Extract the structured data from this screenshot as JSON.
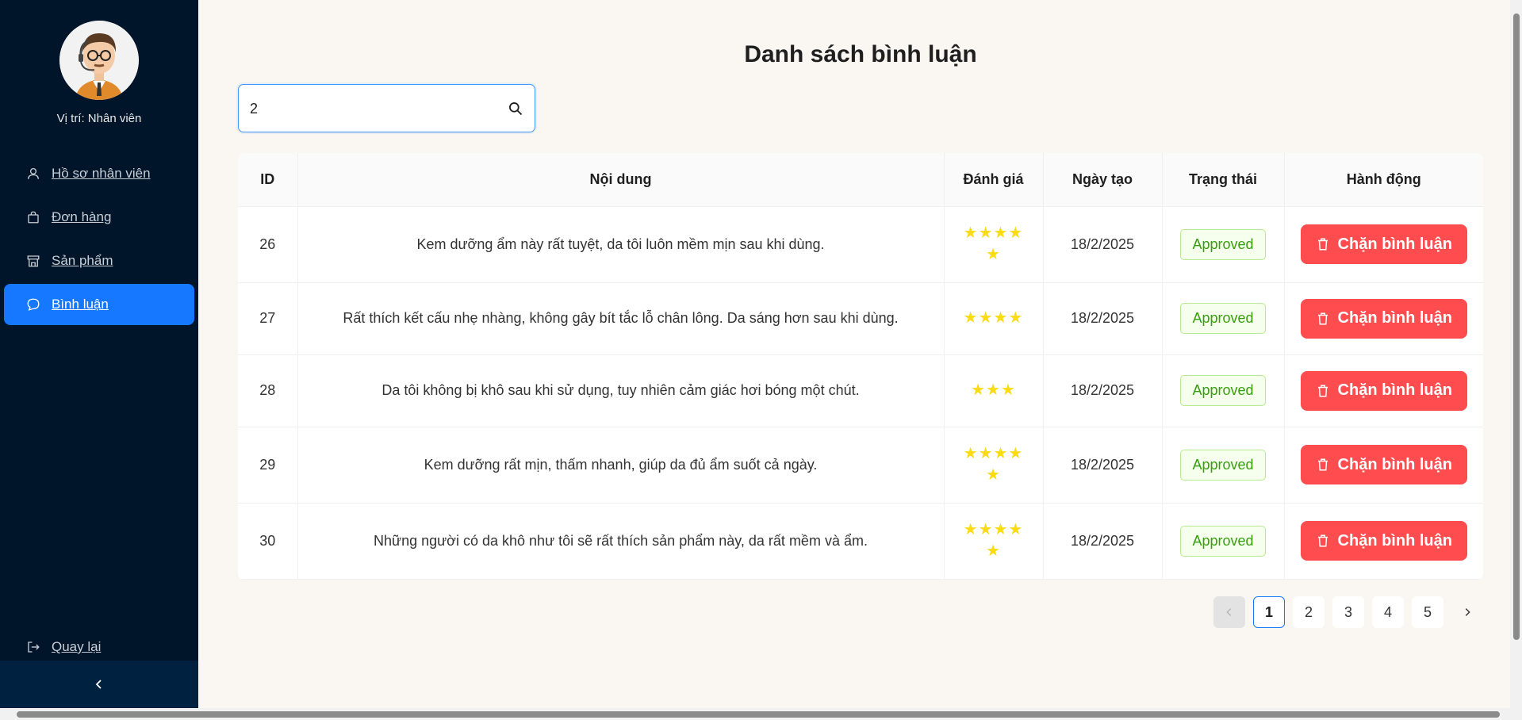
{
  "sidebar": {
    "position_label": "Vị trí: Nhân viên",
    "items": [
      {
        "label": "Hồ sơ nhân viên",
        "icon": "user-icon"
      },
      {
        "label": "Đơn hàng",
        "icon": "shopping-bag-icon"
      },
      {
        "label": "Sản phẩm",
        "icon": "shop-icon"
      },
      {
        "label": "Bình luận",
        "icon": "comment-icon",
        "active": true
      }
    ],
    "back_label": "Quay lại"
  },
  "main": {
    "title": "Danh sách bình luận",
    "search_value": "2"
  },
  "table": {
    "headers": {
      "id": "ID",
      "content": "Nội dung",
      "rating": "Đánh giá",
      "created": "Ngày tạo",
      "status": "Trạng thái",
      "action": "Hành động"
    },
    "rows": [
      {
        "id": "26",
        "content": "Kem dưỡng ẩm này rất tuyệt, da tôi luôn mềm mịn sau khi dùng.",
        "rating": 5,
        "date": "18/2/2025",
        "status": "Approved",
        "action": "Chặn bình luận"
      },
      {
        "id": "27",
        "content": "Rất thích kết cấu nhẹ nhàng, không gây bít tắc lỗ chân lông. Da sáng hơn sau khi dùng.",
        "rating": 4,
        "date": "18/2/2025",
        "status": "Approved",
        "action": "Chặn bình luận"
      },
      {
        "id": "28",
        "content": "Da tôi không bị khô sau khi sử dụng, tuy nhiên cảm giác hơi bóng một chút.",
        "rating": 3,
        "date": "18/2/2025",
        "status": "Approved",
        "action": "Chặn bình luận"
      },
      {
        "id": "29",
        "content": "Kem dưỡng rất mịn, thấm nhanh, giúp da đủ ẩm suốt cả ngày.",
        "rating": 5,
        "date": "18/2/2025",
        "status": "Approved",
        "action": "Chặn bình luận"
      },
      {
        "id": "30",
        "content": "Những người có da khô như tôi sẽ rất thích sản phẩm này, da rất mềm và ẩm.",
        "rating": 5,
        "date": "18/2/2025",
        "status": "Approved",
        "action": "Chặn bình luận"
      }
    ]
  },
  "pagination": {
    "pages": [
      "1",
      "2",
      "3",
      "4",
      "5"
    ],
    "current": "1"
  },
  "colors": {
    "sidebar_bg": "#001529",
    "accent": "#1677ff",
    "danger": "#ff4d4f",
    "success": "#389e0d",
    "star": "#fadb14"
  }
}
